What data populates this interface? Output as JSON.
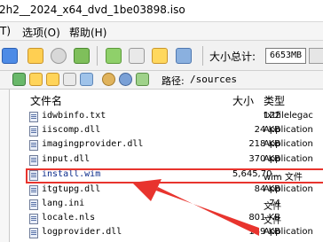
{
  "window": {
    "title": "2h2__2024_x64_dvd_1be03898.iso"
  },
  "menu": [
    {
      "label": "T)"
    },
    {
      "label": "选项(O)"
    },
    {
      "label": "帮助(H)"
    }
  ],
  "toolbar": {
    "size_label": "大小总计:",
    "size_value": "6653MB"
  },
  "pathbar": {
    "label": "路径:",
    "path": "/sources"
  },
  "columns": {
    "name": "文件名",
    "size": "大小",
    "type": "类型"
  },
  "files": [
    {
      "name": "idwbinfo.txt",
      "size": "122",
      "type": "txtfilelegac"
    },
    {
      "name": "iiscomp.dll",
      "size": "24 KB",
      "type": "Application"
    },
    {
      "name": "imagingprovider.dll",
      "size": "218 KB",
      "type": "Application"
    },
    {
      "name": "input.dll",
      "size": "370 KB",
      "type": "Application"
    },
    {
      "name": "install.wim",
      "size": "5,645,70...",
      "type": "wim 文件"
    },
    {
      "name": "itgtupg.dll",
      "size": "84 KB",
      "type": "Application"
    },
    {
      "name": "lang.ini",
      "size": "74",
      "type": "文件"
    },
    {
      "name": "locale.nls",
      "size": "801 KB",
      "type": "文件"
    },
    {
      "name": "logprovider.dll",
      "size": "149 KB",
      "type": "Application"
    }
  ],
  "colors": {
    "highlight": "#e8342e"
  }
}
